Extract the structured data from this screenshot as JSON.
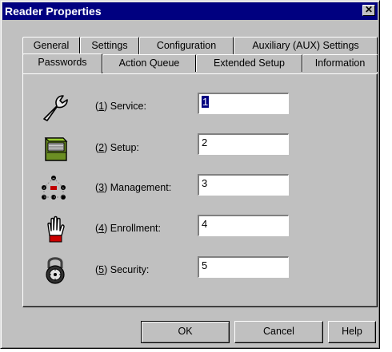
{
  "window": {
    "title": "Reader Properties",
    "close_glyph": "✕"
  },
  "tabs_back": [
    {
      "label": "General"
    },
    {
      "label": "Settings"
    },
    {
      "label": "Configuration"
    },
    {
      "label": "Auxiliary (AUX) Settings"
    }
  ],
  "tabs_front": [
    {
      "label": "Passwords",
      "active": true
    },
    {
      "label": "Action Queue"
    },
    {
      "label": "Extended Setup"
    },
    {
      "label": "Information"
    }
  ],
  "rows": [
    {
      "key": "1",
      "label_rest": ") Service:",
      "value": "1",
      "icon": "wrench-icon"
    },
    {
      "key": "2",
      "label_rest": ") Setup:",
      "value": "2",
      "icon": "setup-box-icon"
    },
    {
      "key": "3",
      "label_rest": ") Management:",
      "value": "3",
      "icon": "network-icon"
    },
    {
      "key": "4",
      "label_rest": ") Enrollment:",
      "value": "4",
      "icon": "hand-icon"
    },
    {
      "key": "5",
      "label_rest": ") Security:",
      "value": "5",
      "icon": "combination-lock-icon"
    }
  ],
  "buttons": {
    "ok": "OK",
    "cancel": "Cancel",
    "help": "Help"
  },
  "colors": {
    "face": "#c0c0c0",
    "titlebar": "#000080",
    "selection": "#000080"
  }
}
